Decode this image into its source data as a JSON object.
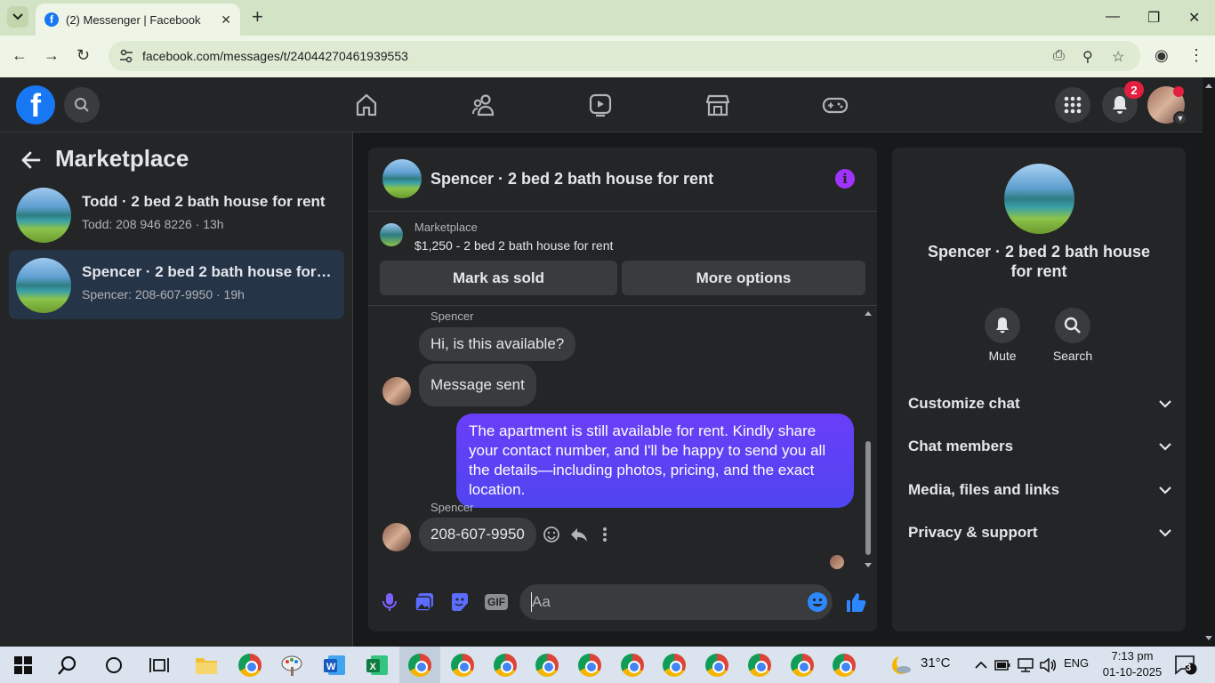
{
  "browser": {
    "tab_title": "(2) Messenger | Facebook",
    "tab_favicon": "f",
    "url": "facebook.com/messages/t/24044270461939553"
  },
  "header": {
    "notification_count": "2"
  },
  "left": {
    "title": "Marketplace",
    "conversations": [
      {
        "title": "Todd · 2 bed 2 bath house for rent",
        "subtitle": "Todd: 208 946 8226 · 13h"
      },
      {
        "title": "Spencer · 2 bed 2 bath house for rent",
        "subtitle": "Spencer: 208-607-9950 · 19h"
      }
    ]
  },
  "chat": {
    "title": "Spencer · 2 bed 2 bath house for rent",
    "listing_label": "Marketplace",
    "listing_price": "$1,250 - 2 bed 2 bath house for rent",
    "mark_sold": "Mark as sold",
    "more_options": "More options",
    "messages": [
      {
        "sender": "Spencer",
        "text": "Hi, is this available?"
      },
      {
        "text": "Message sent"
      },
      {
        "text": "The apartment is still available for rent. Kindly share your contact number, and I'll be happy to send you all the details—including photos, pricing, and the exact location."
      },
      {
        "sender": "Spencer",
        "text": "208-607-9950"
      }
    ],
    "composer_placeholder": "Aa",
    "gif_label": "GIF"
  },
  "right": {
    "title": "Spencer · 2 bed 2 bath house for rent",
    "mute": "Mute",
    "search": "Search",
    "sections": [
      "Customize chat",
      "Chat members",
      "Media, files and links",
      "Privacy & support"
    ]
  },
  "taskbar": {
    "temperature": "31°C",
    "language": "ENG",
    "time": "7:13 pm",
    "date": "01-10-2025",
    "notifications": "3"
  },
  "colors": {
    "accent": "#1877f2",
    "outgoing_bubble": "#5b3df5",
    "info": "#a033ff"
  }
}
